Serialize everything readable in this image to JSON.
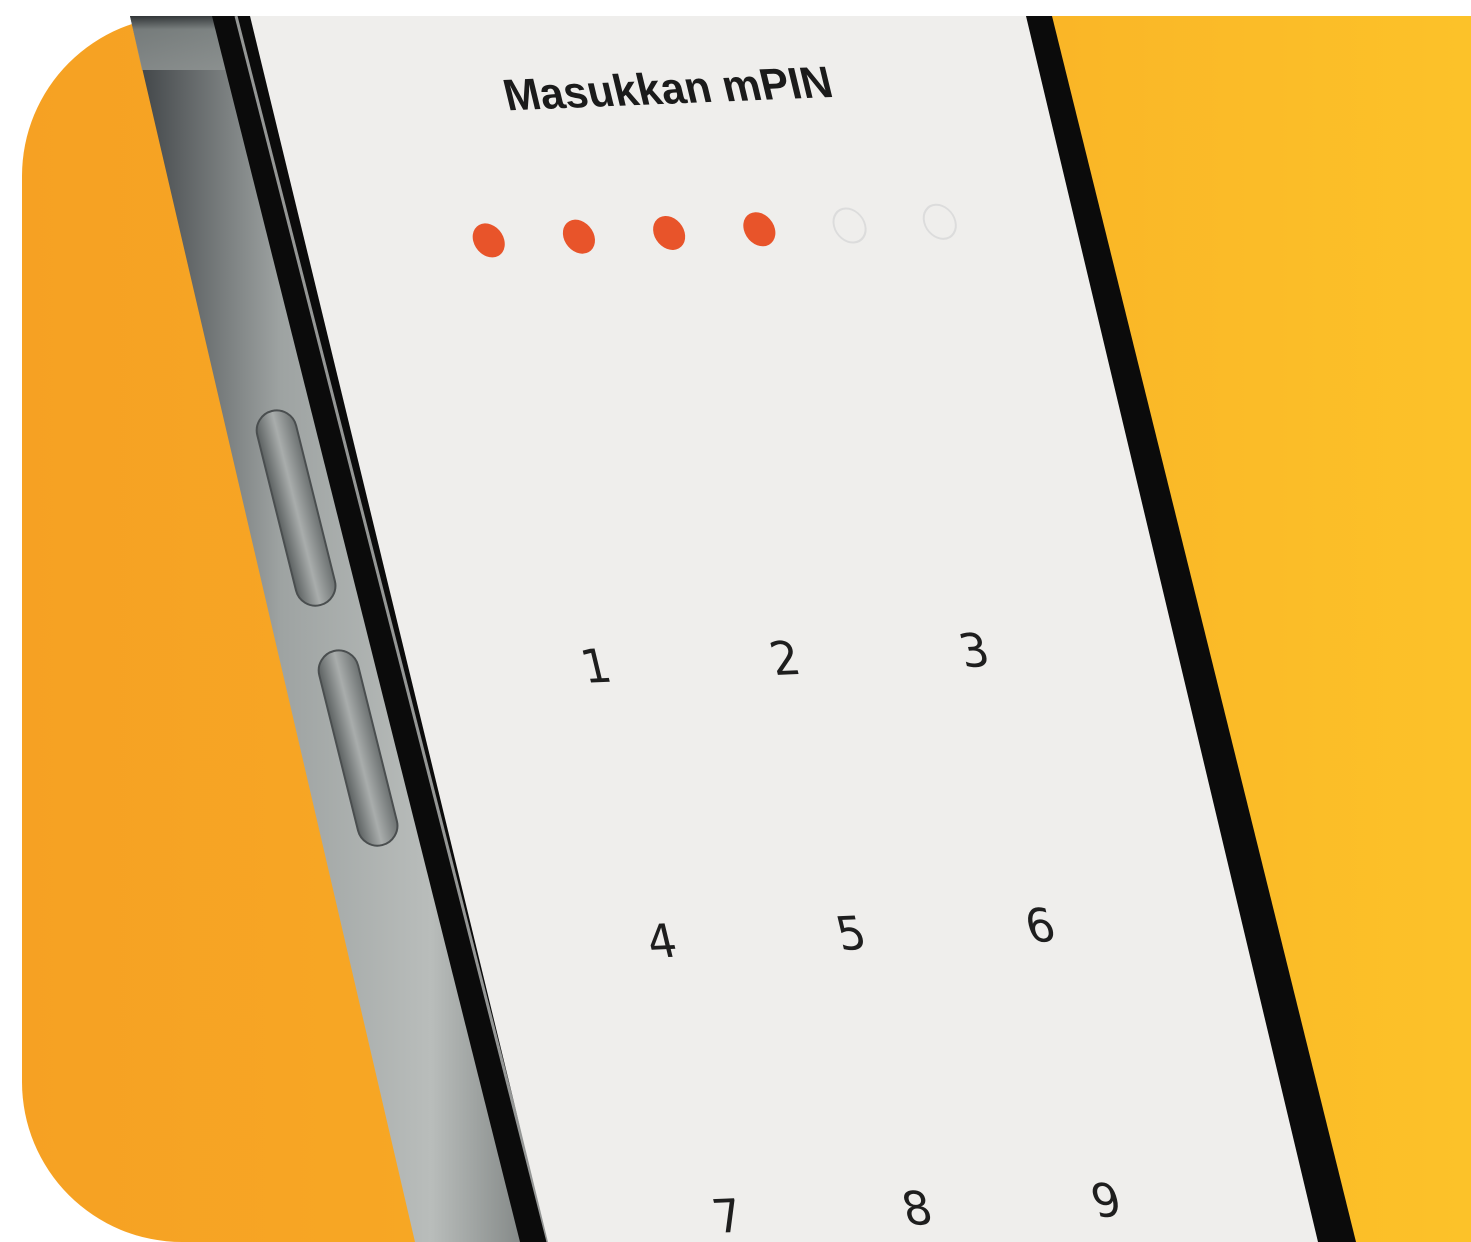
{
  "screen": {
    "title": "Masukkan mPIN"
  },
  "pin": {
    "length": 6,
    "filled": 4,
    "filled_color": "#e8542a",
    "empty_color": "#dcdcdc"
  },
  "keypad": {
    "keys": [
      "1",
      "2",
      "3",
      "4",
      "5",
      "6",
      "7",
      "8",
      "9"
    ]
  },
  "colors": {
    "background_left": "#f6a123",
    "background_right": "#fcc229",
    "screen": "#efeeec",
    "bezel": "#0b0b0b",
    "frame": "#8c9190"
  }
}
